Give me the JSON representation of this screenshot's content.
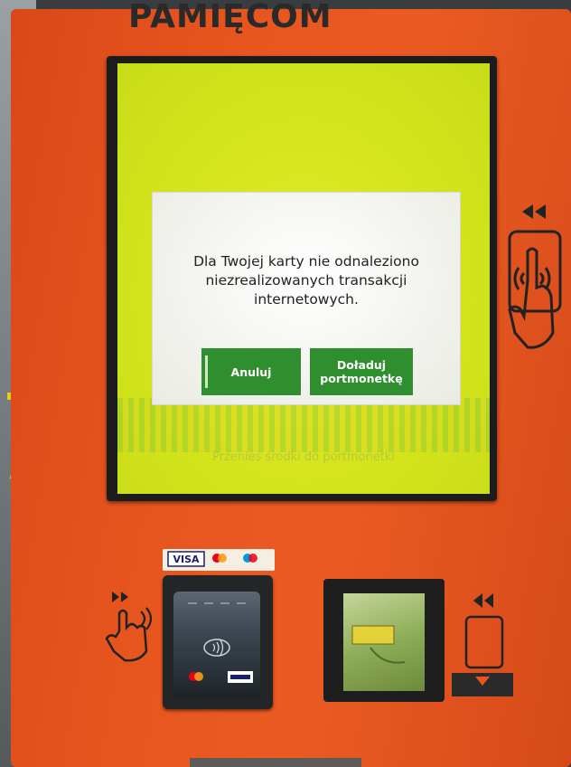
{
  "kiosk": {
    "brand_text": "PAMIĘCOM"
  },
  "dialog": {
    "message": "Dla Twojej karty nie odnaleziono niezrealizowanych transakcji internetowych.",
    "cancel_label": "Anuluj",
    "topup_label": "Doładuj portmonetkę"
  },
  "background_screen": {
    "ghost_bottom_text": "Przenieś środki do portmonetki"
  },
  "payment_sticker": {
    "visa_text": "VISA"
  },
  "icons": [
    "card-tap-icon",
    "hand-left-icon",
    "card-insert-icon",
    "contactless-icon",
    "mastercard-logo",
    "visa-logo"
  ],
  "colors": {
    "panel": "#e8561f",
    "screen": "#d8e61f",
    "button": "#2f8f2f",
    "dialog": "#f4f4f0"
  }
}
